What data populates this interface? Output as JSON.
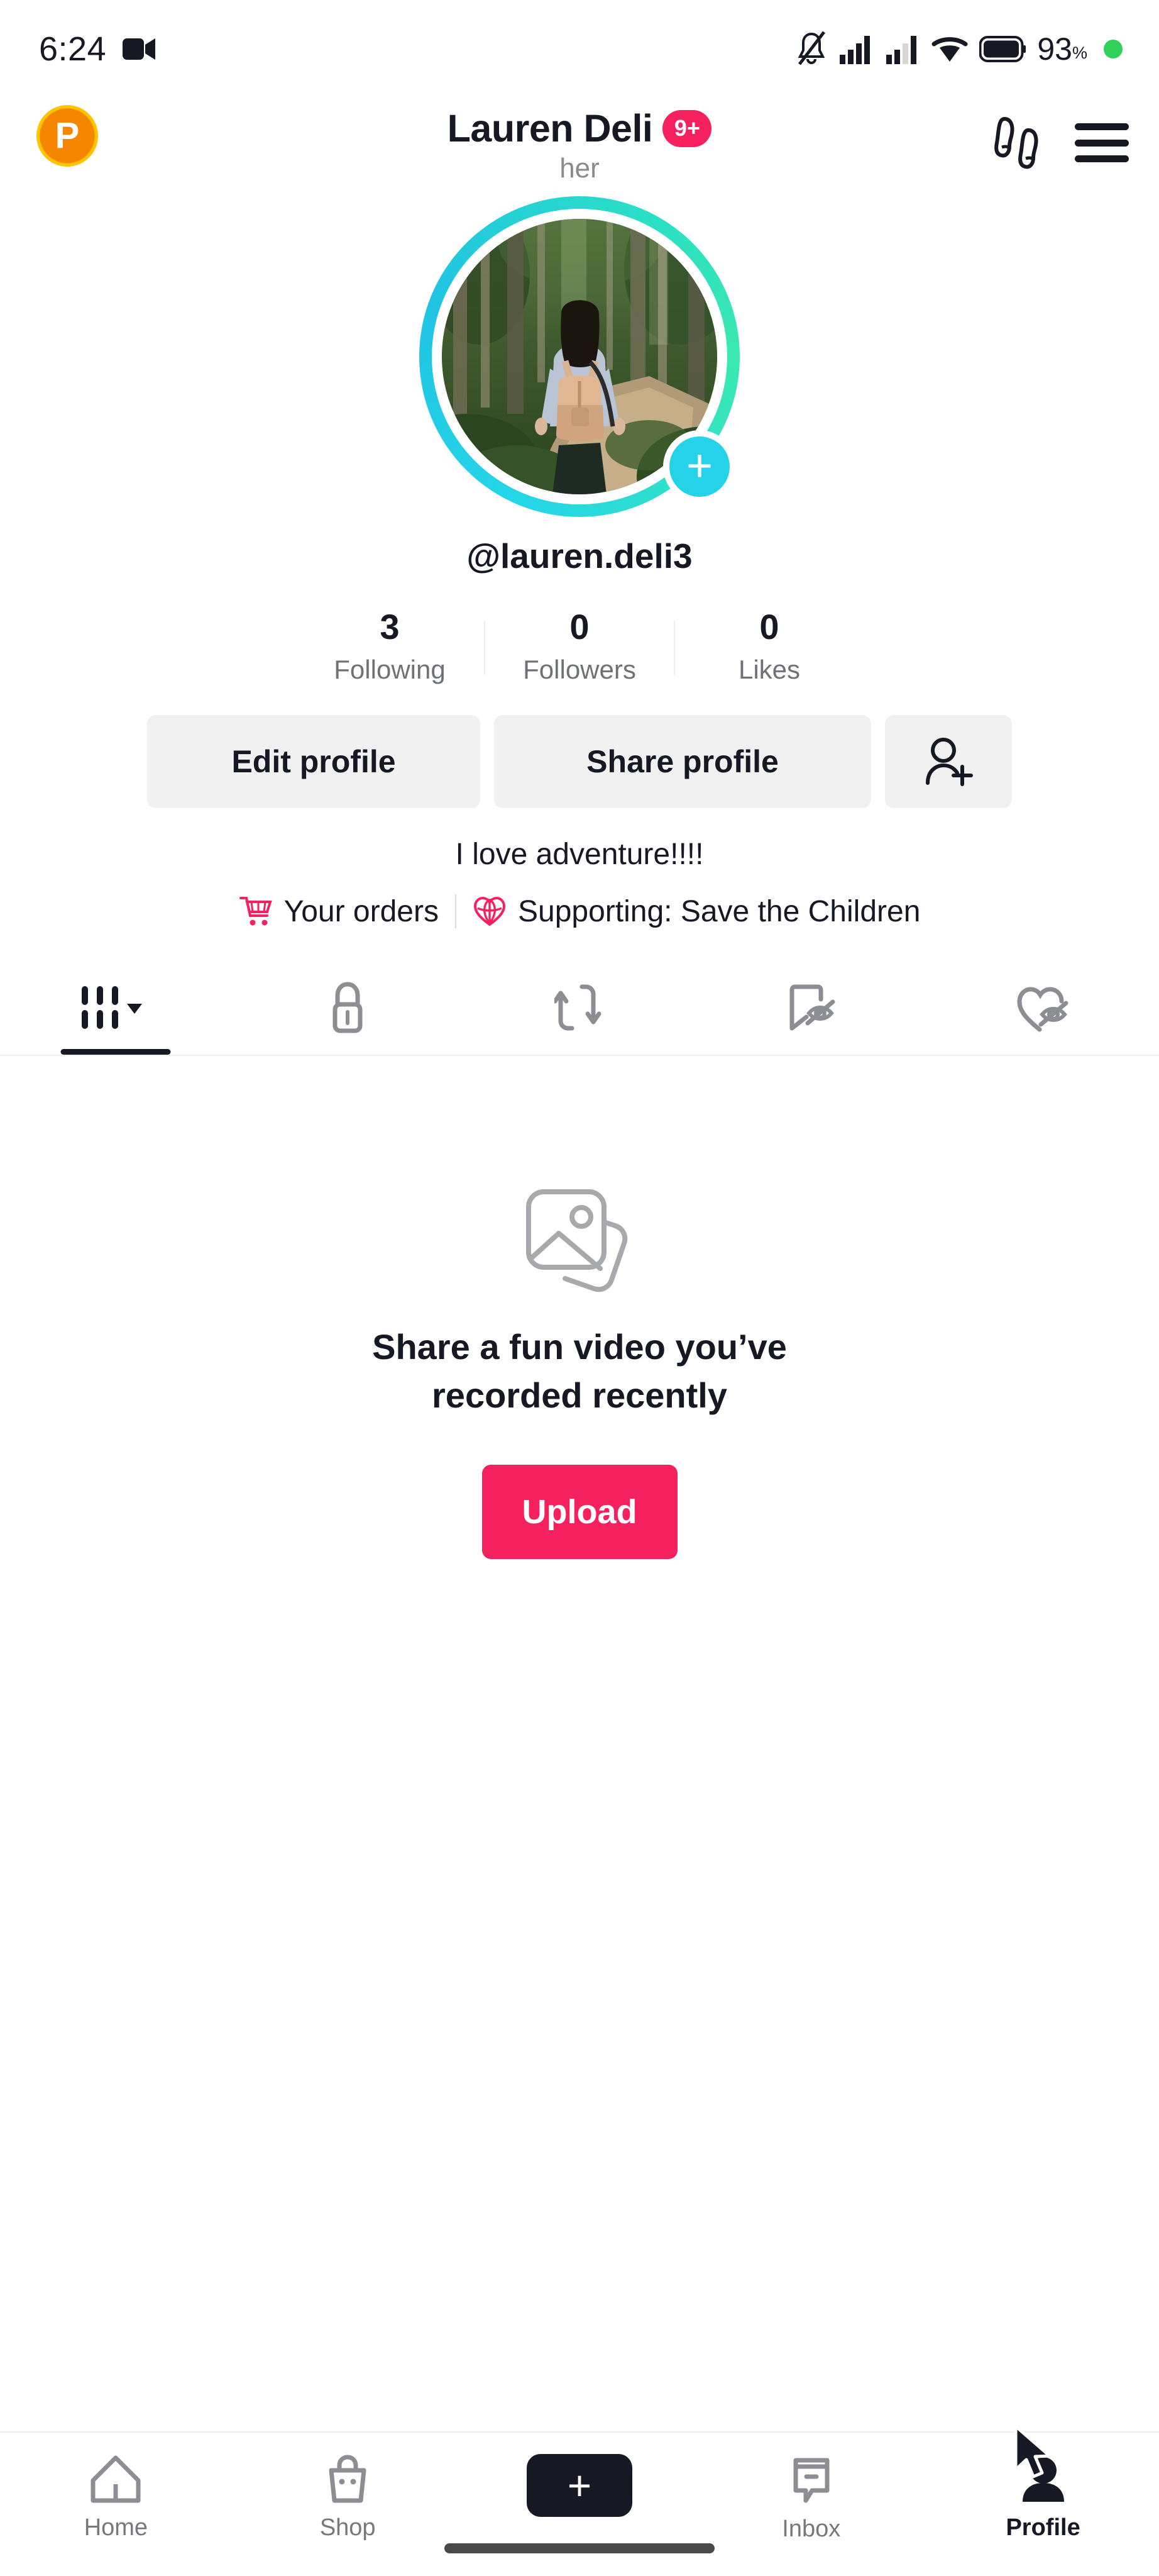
{
  "statusbar": {
    "time": "6:24",
    "camera_icon": "video-camera-icon",
    "mute_icon": "bell-off-icon",
    "signal1_icon": "signal-bars-icon",
    "signal2_icon": "signal-bars-icon",
    "wifi_icon": "wifi-icon",
    "battery_icon": "battery-icon",
    "battery_percent": "93",
    "battery_unit": "%",
    "recording_dot": "green-status-dot"
  },
  "header": {
    "coin_badge": "P",
    "coin_icon": "rewards-coin-icon",
    "title": "Lauren Deli",
    "notification_badge": "9+",
    "pronoun": "her",
    "footprints_icon": "footprints-icon",
    "menu_icon": "hamburger-menu-icon"
  },
  "profile": {
    "avatar_icon": "profile-avatar-photo",
    "avatar_alt": "person hiking with backpack in forest",
    "add_story_icon": "plus-icon",
    "handle": "@lauren.deli3",
    "stats": [
      {
        "count": "3",
        "label": "Following"
      },
      {
        "count": "0",
        "label": "Followers"
      },
      {
        "count": "0",
        "label": "Likes"
      }
    ],
    "buttons": {
      "edit": "Edit profile",
      "share": "Share profile",
      "add_friend_icon": "add-person-icon"
    },
    "bio": "I love adventure!!!!",
    "orders_label": "Your orders",
    "orders_icon": "shopping-cart-icon",
    "supporting_label": "Supporting: Save the Children",
    "supporting_icon": "charity-heart-icon"
  },
  "tabs": [
    {
      "name": "videos-tab",
      "icon": "grid-icon",
      "active": true,
      "has_caret": true
    },
    {
      "name": "private-tab",
      "icon": "lock-icon",
      "active": false,
      "has_caret": false
    },
    {
      "name": "reposts-tab",
      "icon": "repost-arrows-icon",
      "active": false,
      "has_caret": false
    },
    {
      "name": "saved-tab",
      "icon": "bookmark-hidden-icon",
      "active": false,
      "has_caret": false
    },
    {
      "name": "liked-tab",
      "icon": "heart-hidden-icon",
      "active": false,
      "has_caret": false
    }
  ],
  "empty_state": {
    "icon": "stacked-photos-icon",
    "line1": "Share a fun video you’ve",
    "line2": "recorded recently",
    "upload_label": "Upload"
  },
  "bottomnav": [
    {
      "label": "Home",
      "icon": "home-icon",
      "active": false
    },
    {
      "label": "Shop",
      "icon": "shopping-bag-icon",
      "active": false
    },
    {
      "label": "",
      "icon": "create-plus-icon",
      "active": false
    },
    {
      "label": "Inbox",
      "icon": "inbox-message-icon",
      "active": false
    },
    {
      "label": "Profile",
      "icon": "person-icon",
      "active": true
    }
  ],
  "colors": {
    "accent_pink": "#F5215E",
    "tiktok_cyan": "#25F4EE",
    "tiktok_red": "#FE2C55",
    "coin_orange": "#F58700",
    "status_green": "#30d158",
    "muted_gray": "#6f7177"
  }
}
